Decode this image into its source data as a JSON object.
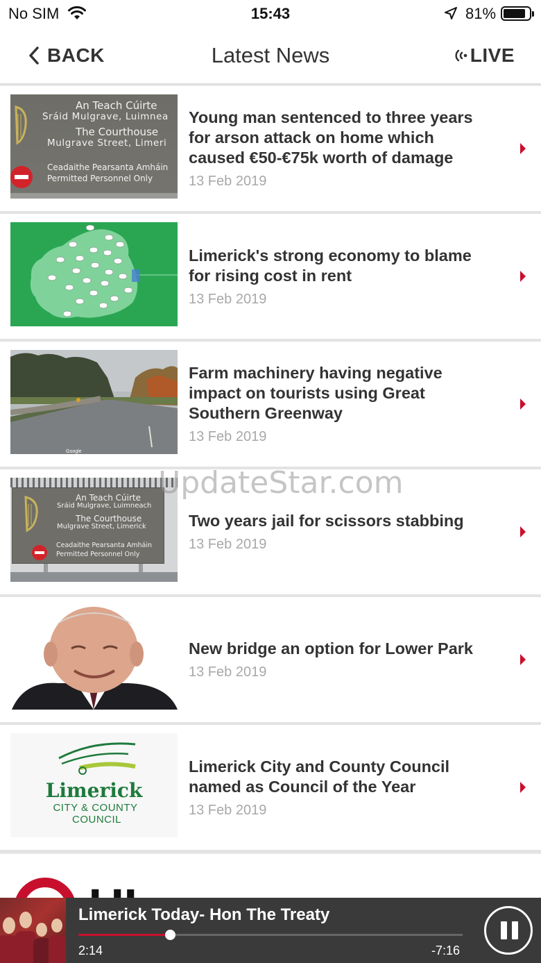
{
  "status": {
    "carrier": "No SIM",
    "time": "15:43",
    "battery": "81%",
    "battery_level": 0.81
  },
  "nav": {
    "back_label": "BACK",
    "title": "Latest News",
    "live_label": "LIVE"
  },
  "articles": [
    {
      "headline": "Young man sentenced to three years for arson attack on home which caused €50-€75k worth of damage",
      "date": "13 Feb 2019",
      "thumb_lines": [
        "An Teach Cúirte",
        "Sráid Mulgrave, Luimnea",
        "The Courthouse",
        "Mulgrave Street, Limeri",
        "Ceadaithe Pearsanta Amháin",
        "Permitted Personnel Only"
      ]
    },
    {
      "headline": "Limerick's strong economy to blame for rising cost in rent",
      "date": "13 Feb 2019"
    },
    {
      "headline": "Farm machinery having negative impact on tourists using Great Southern Greenway",
      "date": "13 Feb 2019",
      "thumb_caption": "Google"
    },
    {
      "headline": "Two years jail for scissors stabbing",
      "date": "13 Feb 2019",
      "thumb_lines": [
        "An Teach Cúirte",
        "Sráid Mulgrave, Luimneach",
        "The Courthouse",
        "Mulgrave Street, Limerick",
        "Ceadaithe Pearsanta Amháin",
        "Permitted Personnel Only"
      ]
    },
    {
      "headline": "New bridge an option for Lower Park",
      "date": "13 Feb 2019"
    },
    {
      "headline": "Limerick City and County Council named as Council of the Year",
      "date": "13 Feb 2019",
      "logo": {
        "line1": "Limerick",
        "line2": "CITY & COUNTY",
        "line3": "COUNCIL"
      }
    }
  ],
  "partial_item": {
    "logo_text": "UL"
  },
  "player": {
    "title": "Limerick Today- Hon The Treaty",
    "elapsed": "2:14",
    "remaining": "-7:16",
    "progress": 0.238
  },
  "watermark": "UpdateStar.com",
  "colors": {
    "accent": "#c8102e",
    "player_bg": "#3a3a3a",
    "text": "#333333",
    "date": "#a8a8a8"
  }
}
